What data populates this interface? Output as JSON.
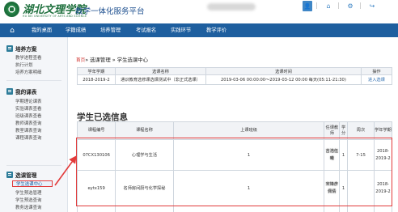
{
  "header": {
    "logo_cn": "湖北文理学院",
    "logo_en": "HU BEI UNIVERSITY OF ARTS AND SCIENCE",
    "system_title": "教学一体化服务平台"
  },
  "nav": {
    "items": [
      "我的桌面",
      "学籍成绩",
      "培养管理",
      "考试报名",
      "实践环节",
      "教学评价"
    ]
  },
  "sidebar": {
    "groups": [
      {
        "label": "培养方案",
        "items": [
          "教学进程查看",
          "执行计划",
          "培养方案明细"
        ]
      },
      {
        "label": "我的课表",
        "items": [
          "学期理论课表",
          "实验课表查看",
          "班级课表查看",
          "教师课表查询",
          "教室课表查询",
          "课程课表查询"
        ]
      },
      {
        "label": "选课管理",
        "items": [
          "学生选课中心",
          "学生预选管理",
          "学生预选查询",
          "教务选课查询"
        ]
      }
    ]
  },
  "breadcrumb": {
    "home": "首页",
    "path": "» 选课管理 » 学生选课中心"
  },
  "selection_table": {
    "headers": [
      "学年学期",
      "选课名称",
      "选课时间",
      "操作"
    ],
    "rows": [
      [
        "2018-2019-2",
        "通识教育选修课选课测试中（非正式选课）",
        "2019-03-06 00:00:00～2019-03-12 00:00 每天(05:11-21:30)",
        "进入选课"
      ]
    ]
  },
  "selected_info": {
    "title": "学生已选信息",
    "headers": [
      "课程编号",
      "课程名称",
      "上课班级",
      "任课教师",
      "学分",
      "周次",
      "学年学期"
    ],
    "rows": [
      {
        "code": "07CX130106",
        "name": "心理学与生活",
        "class": "1",
        "teacher": "吉浩伍曦",
        "credit": "1",
        "weeks": "7-15",
        "term": "2018-2019-2"
      },
      {
        "code": "eytx159",
        "name": "名师房间厨与化学探秘",
        "class": "1",
        "teacher": "宋锋彦佩倩",
        "credit": "1",
        "weeks": "",
        "term": "2018-2019-2"
      },
      {
        "code": "",
        "name": "",
        "class": "",
        "teacher": "",
        "credit": "",
        "weeks": "",
        "term": ""
      }
    ]
  },
  "colors": {
    "nav_bg": "#1e5f9f",
    "brand_green": "#1d6f3c",
    "highlight_red": "#e23b3b"
  }
}
